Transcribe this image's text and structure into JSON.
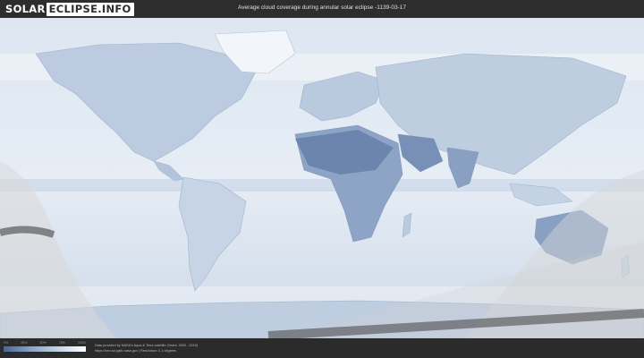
{
  "header": {
    "logo_part1": "SOLAR",
    "logo_part2": "ECLIPSE.INFO",
    "title": "Average cloud coverage during annular solar eclipse -1139-03-17"
  },
  "legend": {
    "ticks": [
      "0%",
      "25%",
      "50%",
      "75%",
      "100%"
    ],
    "colors": [
      "#4a6694",
      "#8aa3c6",
      "#c4d3e6",
      "#ffffff"
    ]
  },
  "credits": {
    "line1": "Data provided by NASA's Aqua & Terra satellite (Years: 2000 - 2019)",
    "line2": "https://neo.sci.gsfc.nasa.gov | Resolution: 0.1 degrees"
  },
  "map": {
    "ocean_color": "#dfe7f1",
    "land_color": "#bfcde0",
    "cloud_clear_color": "#5f7aa4",
    "path_band_color": "#5a5a5a",
    "shadow_overlay_color": "#d8d8d8"
  }
}
